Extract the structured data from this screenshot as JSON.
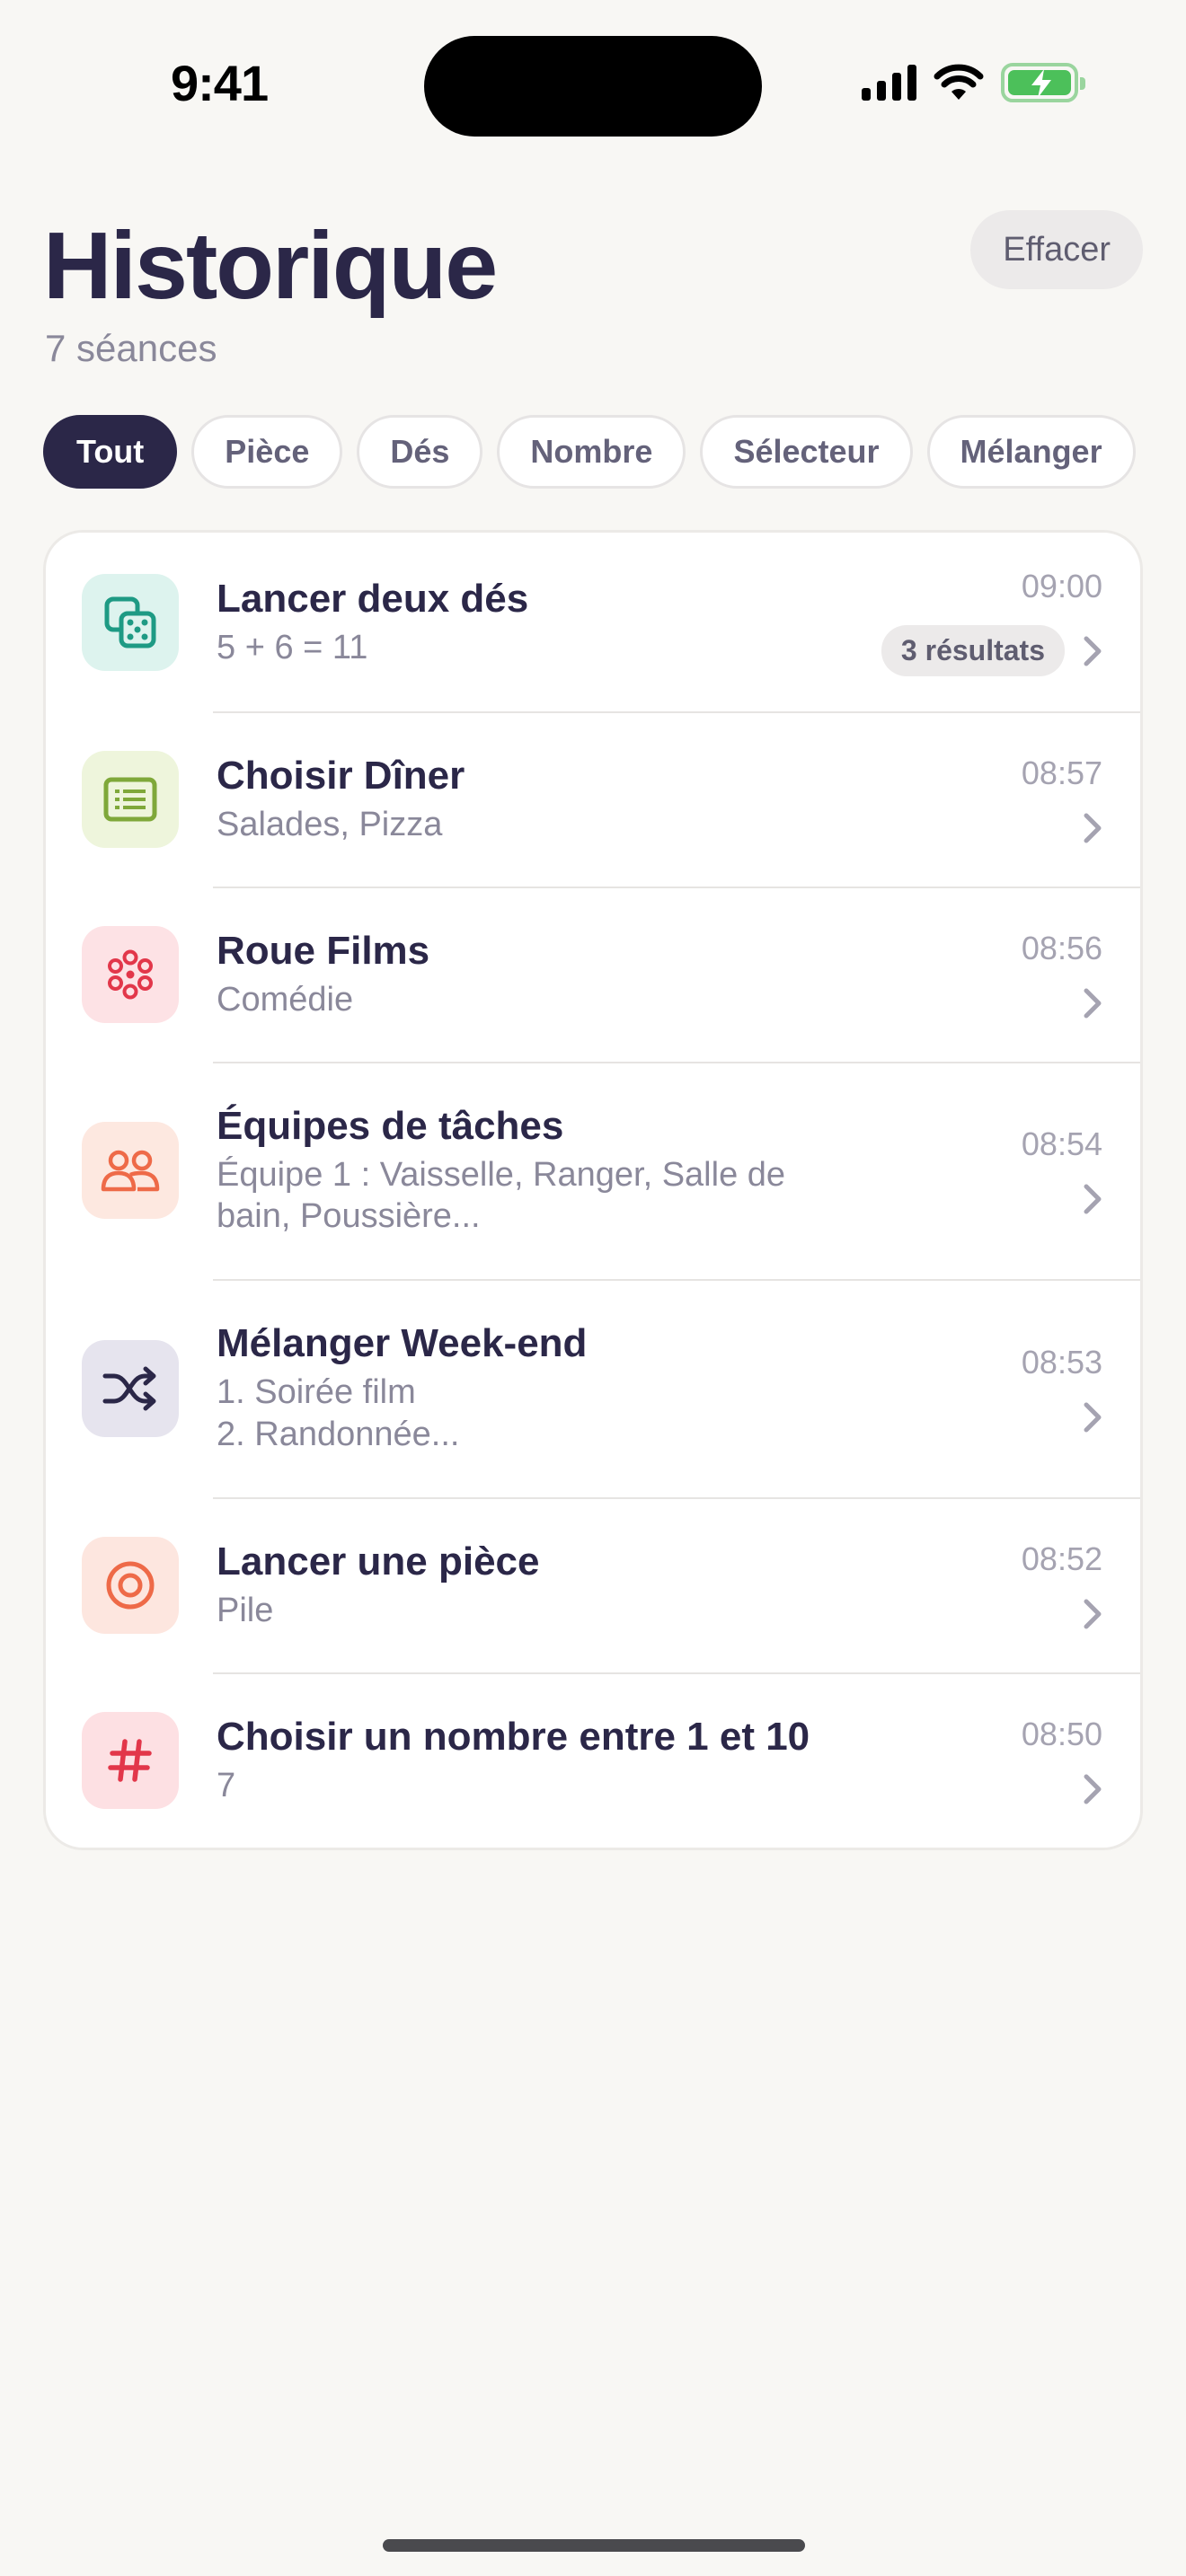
{
  "status_bar": {
    "time": "9:41"
  },
  "header": {
    "title": "Historique",
    "subtitle": "7 séances",
    "clear_label": "Effacer"
  },
  "filters": [
    {
      "label": "Tout",
      "active": true
    },
    {
      "label": "Pièce",
      "active": false
    },
    {
      "label": "Dés",
      "active": false
    },
    {
      "label": "Nombre",
      "active": false
    },
    {
      "label": "Sélecteur",
      "active": false
    },
    {
      "label": "Mélanger",
      "active": false
    }
  ],
  "sessions": [
    {
      "title": "Lancer deux dés",
      "subtitle": "5 + 6 = 11",
      "time": "09:00",
      "badge": "3 résultats",
      "icon": "dice-icon",
      "tile_color": "#DDF3EE",
      "icon_color": "#1E9A84"
    },
    {
      "title": "Choisir Dîner",
      "subtitle": "Salades, Pizza",
      "time": "08:57",
      "icon": "list-card-icon",
      "tile_color": "#EEF5DC",
      "icon_color": "#7FA83A"
    },
    {
      "title": "Roue Films",
      "subtitle": "Comédie",
      "time": "08:56",
      "icon": "wheel-icon",
      "tile_color": "#FDE2E5",
      "icon_color": "#E2374A"
    },
    {
      "title": "Équipes de tâches",
      "subtitle": "Équipe 1 : Vaisselle, Ranger, Salle de bain, Poussière...",
      "time": "08:54",
      "icon": "people-icon",
      "tile_color": "#FDE8E0",
      "icon_color": "#EE6A48"
    },
    {
      "title": "Mélanger Week-end",
      "subtitle": "1. Soirée film\n2. Randonnée...",
      "time": "08:53",
      "icon": "shuffle-icon",
      "tile_color": "#E6E4EE",
      "icon_color": "#2B2748"
    },
    {
      "title": "Lancer une pièce",
      "subtitle": "Pile",
      "time": "08:52",
      "icon": "coin-icon",
      "tile_color": "#FDE6DF",
      "icon_color": "#EE6A48"
    },
    {
      "title": "Choisir un nombre entre 1 et 10",
      "subtitle": "7",
      "time": "08:50",
      "icon": "hash-icon",
      "tile_color": "#FDE0E3",
      "icon_color": "#E2374A"
    }
  ]
}
